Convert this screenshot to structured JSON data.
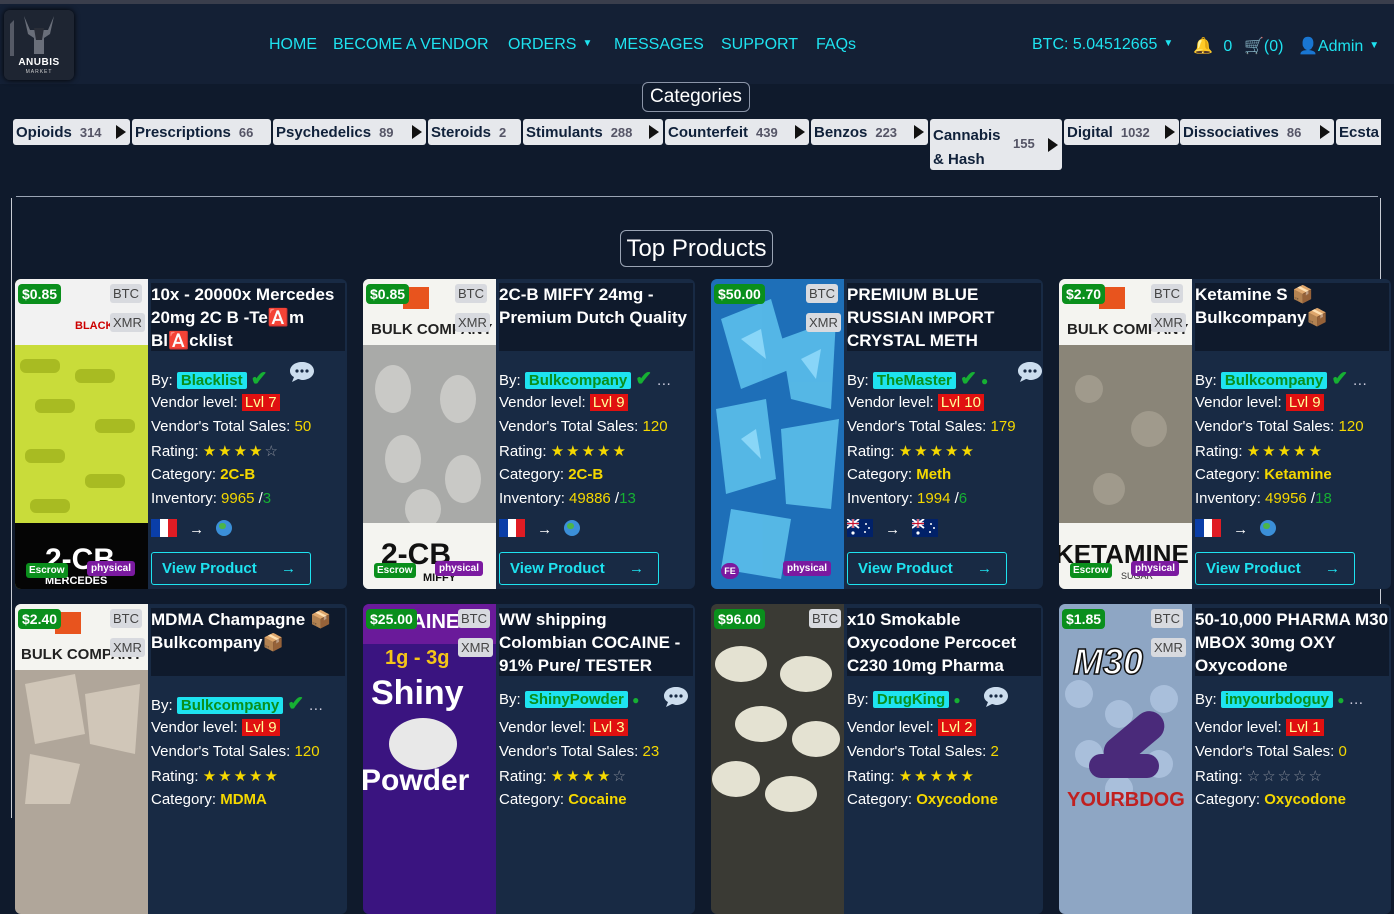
{
  "logo": {
    "name": "ANUBIS",
    "sub": "MARKET"
  },
  "nav": {
    "home": "HOME",
    "become_vendor": "BECOME A VENDOR",
    "orders": "ORDERS",
    "messages": "MESSAGES",
    "support": "SUPPORT",
    "faqs": "FAQs",
    "btc_balance": "BTC: 5.04512665",
    "notifications": "0",
    "cart": "(0)",
    "user": "Admin"
  },
  "categories": {
    "title": "Categories",
    "items": [
      {
        "name": "Opioids",
        "count": "314"
      },
      {
        "name": "Prescriptions",
        "count": "66"
      },
      {
        "name": "Psychedelics",
        "count": "89"
      },
      {
        "name": "Steroids",
        "count": "2"
      },
      {
        "name": "Stimulants",
        "count": "288"
      },
      {
        "name": "Counterfeit",
        "count": "439"
      },
      {
        "name": "Benzos",
        "count": "223"
      },
      {
        "name": "Cannabis & Hash",
        "count": "155"
      },
      {
        "name": "Digital",
        "count": "1032"
      },
      {
        "name": "Dissociatives",
        "count": "86"
      },
      {
        "name": "Ecsta",
        "count": ""
      }
    ]
  },
  "top_products": {
    "title": "Top Products",
    "labels": {
      "by": "By:",
      "vendor_level": "Vendor level:",
      "total_sales": "Vendor's Total Sales:",
      "rating": "Rating:",
      "category": "Category:",
      "inventory": "Inventory:",
      "view": "View Product",
      "escrow": "Escrow",
      "physical": "physical",
      "fe": "FE",
      "btc": "BTC",
      "xmr": "XMR"
    },
    "products": [
      {
        "price": "$0.85",
        "title": "10x - 20000x Mercedes 20mg 2C B -Te🅰️m Bl🅰️cklist",
        "vendor": "Blacklist",
        "level": "Lvl 7",
        "sales": "50",
        "rating": 4,
        "category": "2C-B",
        "inventory": "9965",
        "inventory2": "3"
      },
      {
        "price": "$0.85",
        "title": "2C-B MIFFY 24mg - Premium Dutch Quality",
        "vendor": "Bulkcompany",
        "level": "Lvl 9",
        "sales": "120",
        "rating": 5,
        "category": "2C-B",
        "inventory": "49886",
        "inventory2": "13"
      },
      {
        "price": "$50.00",
        "title": "PREMIUM BLUE RUSSIAN IMPORT CRYSTAL METH",
        "vendor": "TheMaster",
        "level": "Lvl 10",
        "sales": "179",
        "rating": 5,
        "category": "Meth",
        "inventory": "1994",
        "inventory2": "6"
      },
      {
        "price": "$2.70",
        "title": "Ketamine S 📦 Bulkcompany📦",
        "vendor": "Bulkcompany",
        "level": "Lvl 9",
        "sales": "120",
        "rating": 5,
        "category": "Ketamine",
        "inventory": "49956",
        "inventory2": "18"
      },
      {
        "price": "$2.40",
        "title": "MDMA Champagne 📦Bulkcompany📦",
        "vendor": "Bulkcompany",
        "level": "Lvl 9",
        "sales": "120",
        "rating": 5,
        "category": "MDMA"
      },
      {
        "price": "$25.00",
        "title": "WW shipping Colombian COCAINE - 91% Pure/ TESTER",
        "vendor": "ShinyPowder",
        "level": "Lvl 3",
        "sales": "23",
        "rating": 4,
        "category": "Cocaine"
      },
      {
        "price": "$96.00",
        "title": "x10 Smokable Oxycodone Percocet C230 10mg Pharma",
        "vendor": "DrugKing",
        "level": "Lvl 2",
        "sales": "2",
        "rating": 5,
        "category": "Oxycodone"
      },
      {
        "price": "$1.85",
        "title": "50-10,000 PHARMA M30 MBOX 30mg OXY Oxycodone",
        "vendor": "imyourbdoguy",
        "level": "Lvl 1",
        "sales": "0",
        "rating": 0,
        "category": "Oxycodone"
      }
    ],
    "stars": {
      "full4": "★★★★",
      "off1": "☆",
      "full5": "★★★★★",
      "off5": "☆☆☆☆☆"
    }
  },
  "thumb_text": {
    "p1_top": "BLACKLIST",
    "p1_bottom": "2-CB",
    "p1_bottom2": "MERCEDES",
    "p2_top": "BULK COMPANY",
    "p2_bottom": "2-CB",
    "p2_bottom2": "MIFFY",
    "p4_top": "BULK COMPANY",
    "p4_bottom": "KETAMINE",
    "p4_bottom2": "SUGAR",
    "p5_top": "BULK COMPANY",
    "p6_top": "COCAINE",
    "p6_mid": "1g - 3g",
    "p6_big": "Shiny",
    "p6_big2": "Powder",
    "p8_top": "M30",
    "p8_bottom": "YOURBDOG"
  }
}
